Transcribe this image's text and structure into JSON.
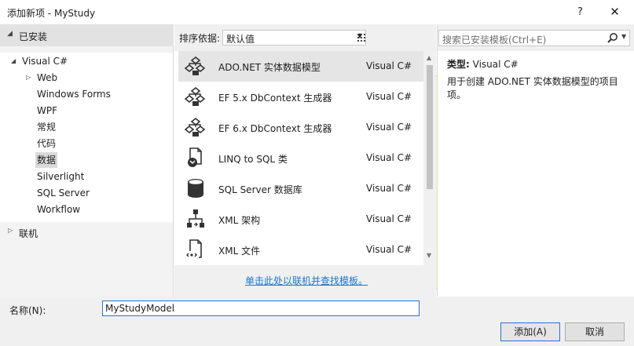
{
  "window": {
    "title": "添加新项 - MyStudy",
    "help_glyph": "?",
    "close_glyph": "✕"
  },
  "sidebar": {
    "installed_label": "已安装",
    "tree": [
      {
        "label": "Visual C#",
        "level": 0,
        "expanded": true
      },
      {
        "label": "Web",
        "level": 1,
        "collapsed": true
      },
      {
        "label": "Windows Forms",
        "level": 1
      },
      {
        "label": "WPF",
        "level": 1
      },
      {
        "label": "常规",
        "level": 1
      },
      {
        "label": "代码",
        "level": 1
      },
      {
        "label": "数据",
        "level": 1,
        "selected": true
      },
      {
        "label": "Silverlight",
        "level": 1
      },
      {
        "label": "SQL Server",
        "level": 1
      },
      {
        "label": "Workflow",
        "level": 1
      }
    ],
    "online_label": "联机"
  },
  "toolbar": {
    "sort_label": "排序依据:",
    "sort_value": "默认值"
  },
  "templates": [
    {
      "name": "ADO.NET 实体数据模型",
      "lang": "Visual C#",
      "icon": "entity-model-icon",
      "selected": true
    },
    {
      "name": "EF 5.x DbContext 生成器",
      "lang": "Visual C#",
      "icon": "entity-model-icon"
    },
    {
      "name": "EF 6.x DbContext 生成器",
      "lang": "Visual C#",
      "icon": "entity-model-icon"
    },
    {
      "name": "LINQ to SQL 类",
      "lang": "Visual C#",
      "icon": "linq-to-sql-icon"
    },
    {
      "name": "SQL Server 数据库",
      "lang": "Visual C#",
      "icon": "database-icon"
    },
    {
      "name": "XML 架构",
      "lang": "Visual C#",
      "icon": "xml-schema-icon"
    },
    {
      "name": "XML 文件",
      "lang": "Visual C#",
      "icon": "xml-file-icon"
    }
  ],
  "online_link": "单击此处以联机并查找模板。",
  "search": {
    "placeholder": "搜索已安装模板(Ctrl+E)"
  },
  "details": {
    "type_label": "类型:",
    "type_value": "Visual C#",
    "description": "用于创建 ADO.NET 实体数据模型的项目项。"
  },
  "footer": {
    "name_label": "名称(N):",
    "name_value": "MyStudyModel",
    "add_button": "添加(A)",
    "cancel_button": "取消"
  }
}
